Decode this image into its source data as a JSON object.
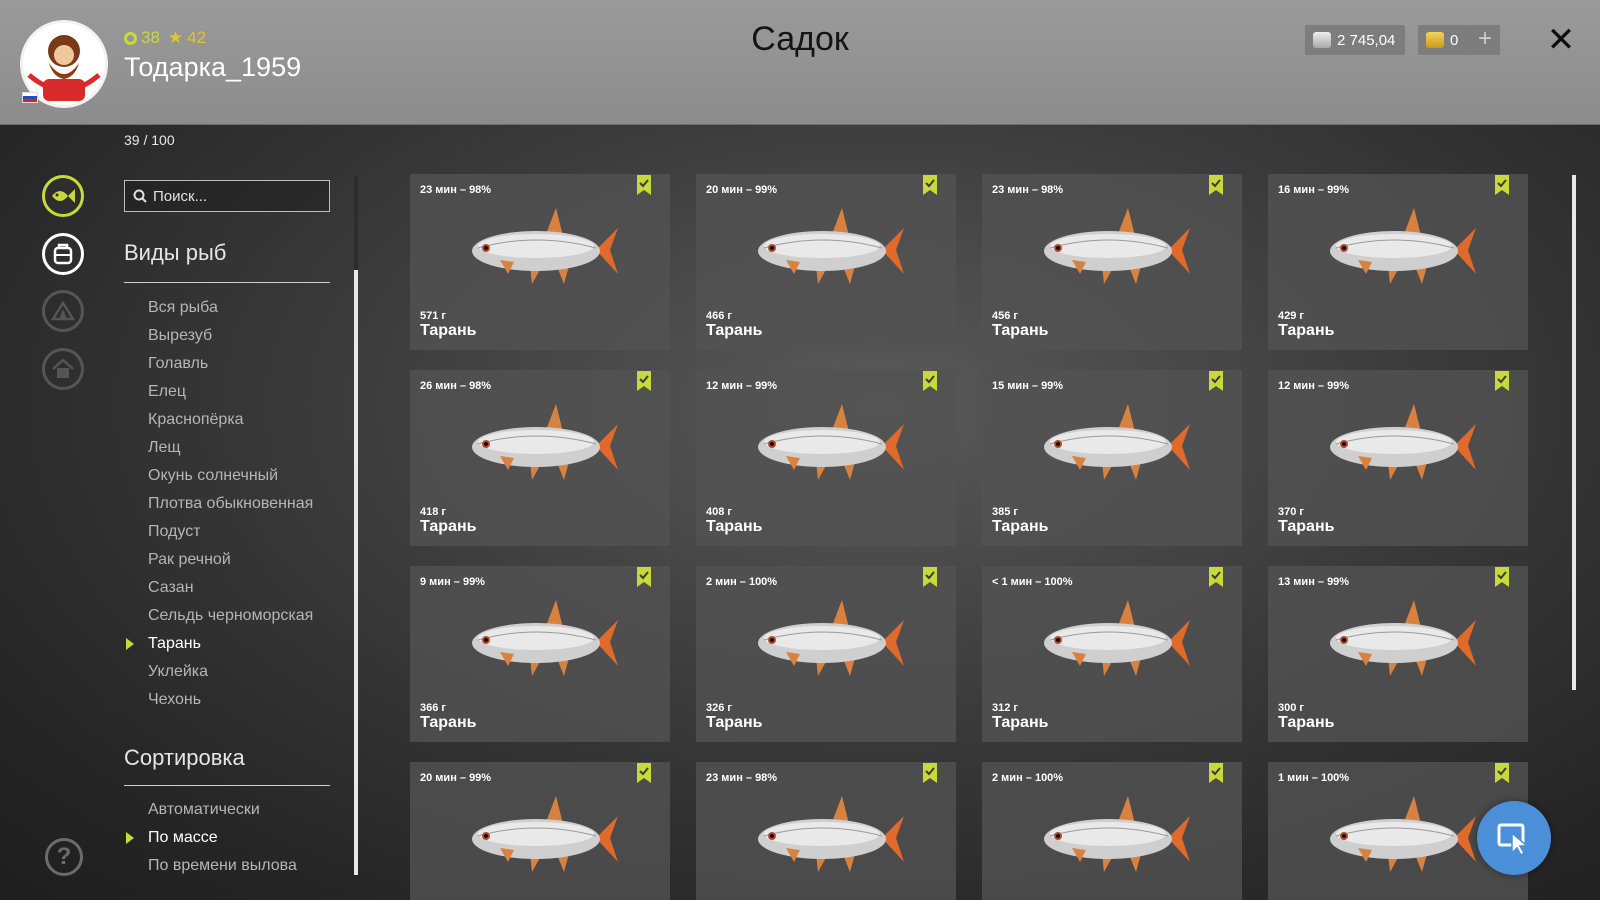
{
  "header": {
    "title": "Садок",
    "player": {
      "level": "38",
      "rank": "42",
      "name": "Тодарка_1959"
    },
    "currency": {
      "silver": "2 745,04",
      "gold": "0"
    },
    "add_label": "+",
    "close_label": "✕"
  },
  "capacity": "39 / 100",
  "sidebar": {
    "search_placeholder": "Поиск...",
    "species_title": "Виды рыб",
    "species": [
      "Вся рыба",
      "Вырезуб",
      "Голавль",
      "Елец",
      "Краснопёрка",
      "Лещ",
      "Окунь солнечный",
      "Плотва обыкновенная",
      "Подуст",
      "Рак речной",
      "Сазан",
      "Сельдь черноморская",
      "Тарань",
      "Уклейка",
      "Чехонь"
    ],
    "species_active": "Тарань",
    "sort_title": "Сортировка",
    "sort": [
      "Автоматически",
      "По массе",
      "По времени вылова"
    ],
    "sort_active": "По массе",
    "help_label": "?"
  },
  "fish_cards": [
    {
      "time": "23 мин – 98%",
      "weight": "571 г",
      "name": "Тарань"
    },
    {
      "time": "20 мин – 99%",
      "weight": "466 г",
      "name": "Тарань"
    },
    {
      "time": "23 мин – 98%",
      "weight": "456 г",
      "name": "Тарань"
    },
    {
      "time": "16 мин – 99%",
      "weight": "429 г",
      "name": "Тарань"
    },
    {
      "time": "26 мин – 98%",
      "weight": "418 г",
      "name": "Тарань"
    },
    {
      "time": "12 мин – 99%",
      "weight": "408 г",
      "name": "Тарань"
    },
    {
      "time": "15 мин – 99%",
      "weight": "385 г",
      "name": "Тарань"
    },
    {
      "time": "12 мин – 99%",
      "weight": "370 г",
      "name": "Тарань"
    },
    {
      "time": "9 мин – 99%",
      "weight": "366 г",
      "name": "Тарань"
    },
    {
      "time": "2 мин – 100%",
      "weight": "326 г",
      "name": "Тарань"
    },
    {
      "time": "< 1 мин – 100%",
      "weight": "312 г",
      "name": "Тарань"
    },
    {
      "time": "13 мин – 99%",
      "weight": "300 г",
      "name": "Тарань"
    },
    {
      "time": "20 мин – 99%",
      "weight": "",
      "name": ""
    },
    {
      "time": "23 мин – 98%",
      "weight": "",
      "name": ""
    },
    {
      "time": "2 мин – 100%",
      "weight": "",
      "name": ""
    },
    {
      "time": "1 мин – 100%",
      "weight": "",
      "name": ""
    }
  ],
  "colors": {
    "accent": "#c8d93a",
    "header_bg": "#9a9a9a",
    "card_bg": "#525252",
    "cursor_button": "#4a8fd8"
  },
  "icons": {
    "rail": [
      "fish-icon",
      "keepnet-icon",
      "tent-icon",
      "home-icon"
    ],
    "bookmark": "bookmark-check-icon",
    "cursor": "cursor-icon"
  }
}
